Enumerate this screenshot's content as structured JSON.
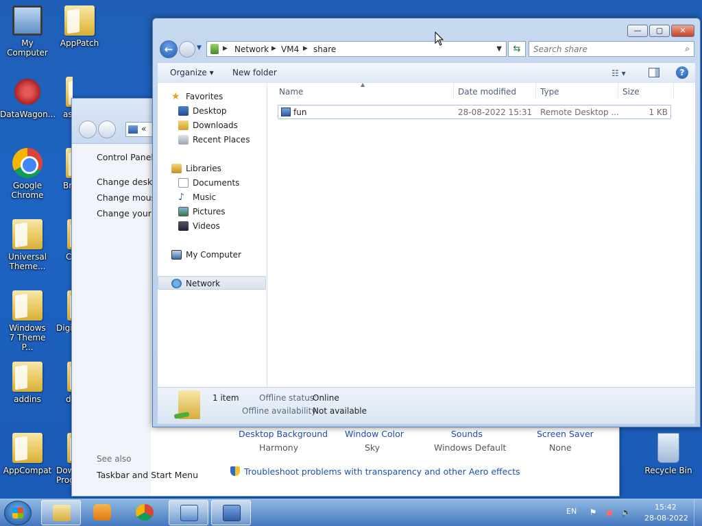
{
  "desktop": {
    "icons": [
      {
        "label": "My Computer"
      },
      {
        "label": "AppPatch"
      },
      {
        "label": "DataWagon..."
      },
      {
        "label": "as"
      },
      {
        "label": "Google Chrome"
      },
      {
        "label": "Br"
      },
      {
        "label": "Universal Theme..."
      },
      {
        "label": "C"
      },
      {
        "label": "Windows 7 Theme P..."
      },
      {
        "label": "Digi"
      },
      {
        "label": "addins"
      },
      {
        "label": "d"
      },
      {
        "label": "AppCompat"
      },
      {
        "label": "Dow Prog"
      },
      {
        "label": "Recycle Bin"
      }
    ]
  },
  "control_panel": {
    "address_text": "«",
    "home_link": "Control Panel",
    "links": [
      "Change deskto",
      "Change mouse",
      "Change your a"
    ],
    "see_also": "See also",
    "taskbar_link": "Taskbar and Start Menu",
    "theme_items": [
      {
        "label": "Desktop Background",
        "value": "Harmony"
      },
      {
        "label": "Window Color",
        "value": "Sky"
      },
      {
        "label": "Sounds",
        "value": "Windows Default"
      },
      {
        "label": "Screen Saver",
        "value": "None"
      }
    ],
    "troubleshoot": "Troubleshoot problems with transparency and other Aero effects"
  },
  "explorer": {
    "caption": {
      "minimize": "—",
      "maximize": "▢",
      "close": "✕"
    },
    "breadcrumbs": [
      "Network",
      "VM4",
      "share"
    ],
    "search_placeholder": "Search share",
    "commands": {
      "organize": "Organize ▾",
      "new_folder": "New folder"
    },
    "nav": {
      "favorites": "Favorites",
      "desktop": "Desktop",
      "downloads": "Downloads",
      "recent": "Recent Places",
      "libraries": "Libraries",
      "documents": "Documents",
      "music": "Music",
      "pictures": "Pictures",
      "videos": "Videos",
      "computer": "My Computer",
      "network": "Network"
    },
    "columns": [
      "Name",
      "Date modified",
      "Type",
      "Size"
    ],
    "files": [
      {
        "name": "fun",
        "date": "28-08-2022 15:31",
        "type": "Remote Desktop ...",
        "size": "1 KB"
      }
    ],
    "details": {
      "count": "1 item",
      "offline_status_label": "Offline status:",
      "offline_status_value": "Online",
      "offline_avail_label": "Offline availability:",
      "offline_avail_value": "Not available"
    }
  },
  "taskbar": {
    "language": "EN",
    "time": "15:42",
    "date": "28-08-2022"
  },
  "colors": {
    "accent": "#1d4fb0",
    "desktop": "#1e64c4"
  }
}
